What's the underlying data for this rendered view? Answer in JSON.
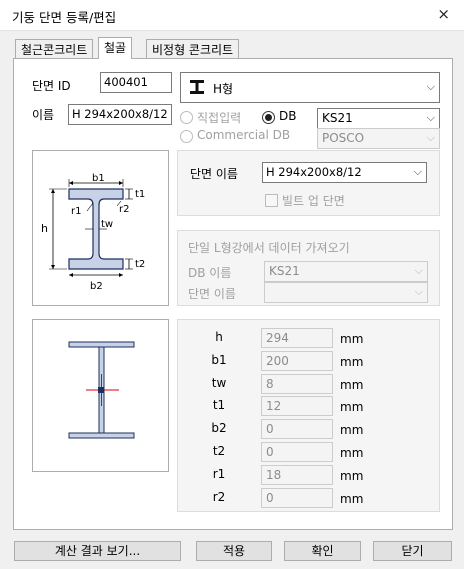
{
  "window": {
    "title": "기둥 단면 등록/편집",
    "close_glyph": "×"
  },
  "tabs": [
    {
      "label": "철근콘크리트"
    },
    {
      "label": "철골"
    },
    {
      "label": "비정형 콘크리트"
    }
  ],
  "section_id": {
    "label": "단면 ID",
    "value": "400401"
  },
  "name": {
    "label": "이름",
    "value": "H 294x200x8/12"
  },
  "shape_type": {
    "icon": "h-beam-icon",
    "value": "H형"
  },
  "input_mode": {
    "direct": "직접입력",
    "db": "DB",
    "commercial_db": "Commercial DB",
    "selected": "DB"
  },
  "db_standard": {
    "value": "KS21"
  },
  "commercial_db_combo": {
    "value": "POSCO"
  },
  "section_name": {
    "label": "단면 이름",
    "value": "H 294x200x8/12"
  },
  "built_up": {
    "label": "빌트 업 단면",
    "checked": false
  },
  "import_group": {
    "title": "단일 L형강에서 데이터 가져오기",
    "db_name_label": "DB 이름",
    "db_name_value": "KS21",
    "section_name_label": "단면 이름",
    "section_name_value": ""
  },
  "diagram_labels": {
    "b1": "b1",
    "t1": "t1",
    "r1": "r1",
    "r2": "r2",
    "h": "h",
    "tw": "tw",
    "t2": "t2",
    "b2": "b2"
  },
  "dimensions": [
    {
      "name": "h",
      "value": "294",
      "unit": "mm"
    },
    {
      "name": "b1",
      "value": "200",
      "unit": "mm"
    },
    {
      "name": "tw",
      "value": "8",
      "unit": "mm"
    },
    {
      "name": "t1",
      "value": "12",
      "unit": "mm"
    },
    {
      "name": "b2",
      "value": "0",
      "unit": "mm"
    },
    {
      "name": "t2",
      "value": "0",
      "unit": "mm"
    },
    {
      "name": "r1",
      "value": "18",
      "unit": "mm"
    },
    {
      "name": "r2",
      "value": "0",
      "unit": "mm"
    }
  ],
  "buttons": {
    "calc": "계산 결과 보기...",
    "apply": "적용",
    "ok": "확인",
    "close": "닫기"
  },
  "colors": {
    "section_fill": "#c8d2e6",
    "outline": "#1f2f5f",
    "centroid": "#e00000"
  }
}
